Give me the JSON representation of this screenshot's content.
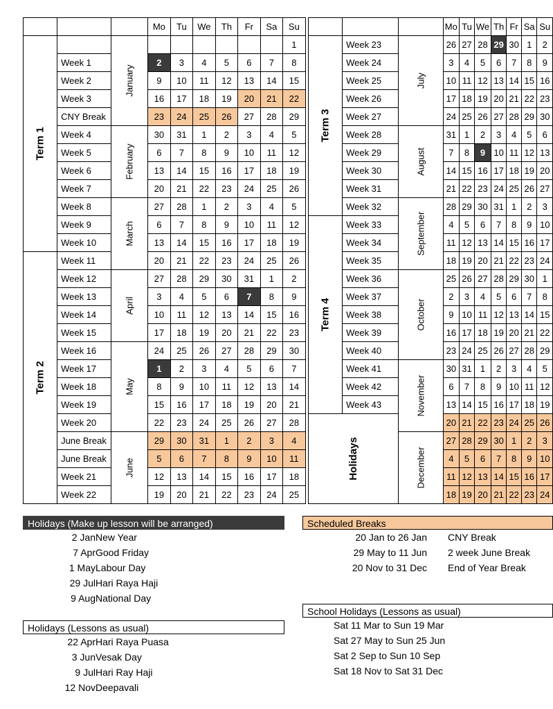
{
  "colors": {
    "accent_orange": "#f7c89c",
    "dark": "#3b3b3b",
    "border": "#000000"
  },
  "day_headers": [
    "Mo",
    "Tu",
    "We",
    "Th",
    "Fr",
    "Sa",
    "Su"
  ],
  "left_table": {
    "terms": [
      {
        "label": "Term 1",
        "rows": 12
      },
      {
        "label": "Term 2",
        "rows": 14
      }
    ],
    "months": [
      {
        "label": "January",
        "rows": 5
      },
      {
        "label": "February",
        "rows": 4
      },
      {
        "label": "March",
        "rows": 4
      },
      {
        "label": "April",
        "rows": 4
      },
      {
        "label": "May",
        "rows": 5
      },
      {
        "label": "June",
        "rows": 4
      }
    ],
    "rows": [
      {
        "week": "",
        "days": [
          "",
          "",
          "",
          "",
          "",
          "",
          "1"
        ],
        "marks": [
          "",
          "",
          "",
          "",
          "",
          "",
          ""
        ]
      },
      {
        "week": "Week 1",
        "days": [
          "2",
          "3",
          "4",
          "5",
          "6",
          "7",
          "8"
        ],
        "marks": [
          "dark",
          "",
          "",
          "",
          "",
          "",
          ""
        ]
      },
      {
        "week": "Week 2",
        "days": [
          "9",
          "10",
          "11",
          "12",
          "13",
          "14",
          "15"
        ],
        "marks": [
          "",
          "",
          "",
          "",
          "",
          "",
          ""
        ]
      },
      {
        "week": "Week 3",
        "days": [
          "16",
          "17",
          "18",
          "19",
          "20",
          "21",
          "22"
        ],
        "marks": [
          "",
          "",
          "",
          "",
          "orange",
          "orange",
          "orange"
        ]
      },
      {
        "week": "CNY Break",
        "days": [
          "23",
          "24",
          "25",
          "26",
          "27",
          "28",
          "29"
        ],
        "marks": [
          "orange",
          "orange",
          "orange",
          "orange",
          "",
          "",
          ""
        ]
      },
      {
        "week": "Week 4",
        "days": [
          "30",
          "31",
          "1",
          "2",
          "3",
          "4",
          "5"
        ],
        "marks": [
          "",
          "",
          "",
          "",
          "",
          "",
          ""
        ]
      },
      {
        "week": "Week 5",
        "days": [
          "6",
          "7",
          "8",
          "9",
          "10",
          "11",
          "12"
        ],
        "marks": [
          "",
          "",
          "",
          "",
          "",
          "",
          ""
        ]
      },
      {
        "week": "Week 6",
        "days": [
          "13",
          "14",
          "15",
          "16",
          "17",
          "18",
          "19"
        ],
        "marks": [
          "",
          "",
          "",
          "",
          "",
          "",
          ""
        ]
      },
      {
        "week": "Week 7",
        "days": [
          "20",
          "21",
          "22",
          "23",
          "24",
          "25",
          "26"
        ],
        "marks": [
          "",
          "",
          "",
          "",
          "",
          "",
          ""
        ]
      },
      {
        "week": "Week 8",
        "days": [
          "27",
          "28",
          "1",
          "2",
          "3",
          "4",
          "5"
        ],
        "marks": [
          "",
          "",
          "",
          "",
          "",
          "",
          ""
        ]
      },
      {
        "week": "Week 9",
        "days": [
          "6",
          "7",
          "8",
          "9",
          "10",
          "11",
          "12"
        ],
        "marks": [
          "",
          "",
          "",
          "",
          "",
          "",
          ""
        ]
      },
      {
        "week": "Week 10",
        "days": [
          "13",
          "14",
          "15",
          "16",
          "17",
          "18",
          "19"
        ],
        "marks": [
          "",
          "",
          "",
          "",
          "",
          "",
          ""
        ]
      },
      {
        "week": "Week 11",
        "days": [
          "20",
          "21",
          "22",
          "23",
          "24",
          "25",
          "26"
        ],
        "marks": [
          "",
          "",
          "",
          "",
          "",
          "",
          ""
        ]
      },
      {
        "week": "Week 12",
        "days": [
          "27",
          "28",
          "29",
          "30",
          "31",
          "1",
          "2"
        ],
        "marks": [
          "",
          "",
          "",
          "",
          "",
          "",
          ""
        ]
      },
      {
        "week": "Week 13",
        "days": [
          "3",
          "4",
          "5",
          "6",
          "7",
          "8",
          "9"
        ],
        "marks": [
          "",
          "",
          "",
          "",
          "dark",
          "",
          ""
        ]
      },
      {
        "week": "Week 14",
        "days": [
          "10",
          "11",
          "12",
          "13",
          "14",
          "15",
          "16"
        ],
        "marks": [
          "",
          "",
          "",
          "",
          "",
          "",
          ""
        ]
      },
      {
        "week": "Week 15",
        "days": [
          "17",
          "18",
          "19",
          "20",
          "21",
          "22",
          "23"
        ],
        "marks": [
          "",
          "",
          "",
          "",
          "",
          "",
          ""
        ]
      },
      {
        "week": "Week 16",
        "days": [
          "24",
          "25",
          "26",
          "27",
          "28",
          "29",
          "30"
        ],
        "marks": [
          "",
          "",
          "",
          "",
          "",
          "",
          ""
        ]
      },
      {
        "week": "Week 17",
        "days": [
          "1",
          "2",
          "3",
          "4",
          "5",
          "6",
          "7"
        ],
        "marks": [
          "dark",
          "",
          "",
          "",
          "",
          "",
          ""
        ]
      },
      {
        "week": "Week 18",
        "days": [
          "8",
          "9",
          "10",
          "11",
          "12",
          "13",
          "14"
        ],
        "marks": [
          "",
          "",
          "",
          "",
          "",
          "",
          ""
        ]
      },
      {
        "week": "Week 19",
        "days": [
          "15",
          "16",
          "17",
          "18",
          "19",
          "20",
          "21"
        ],
        "marks": [
          "",
          "",
          "",
          "",
          "",
          "",
          ""
        ]
      },
      {
        "week": "Week 20",
        "days": [
          "22",
          "23",
          "24",
          "25",
          "26",
          "27",
          "28"
        ],
        "marks": [
          "",
          "",
          "",
          "",
          "",
          "",
          ""
        ]
      },
      {
        "week": "June Break",
        "days": [
          "29",
          "30",
          "31",
          "1",
          "2",
          "3",
          "4"
        ],
        "marks": [
          "orange",
          "orange",
          "orange",
          "orange",
          "orange",
          "orange",
          "orange"
        ]
      },
      {
        "week": "June Break",
        "days": [
          "5",
          "6",
          "7",
          "8",
          "9",
          "10",
          "11"
        ],
        "marks": [
          "orange",
          "orange",
          "orange",
          "orange",
          "orange",
          "orange",
          "orange"
        ]
      },
      {
        "week": "Week 21",
        "days": [
          "12",
          "13",
          "14",
          "15",
          "16",
          "17",
          "18"
        ],
        "marks": [
          "",
          "",
          "",
          "",
          "",
          "",
          ""
        ]
      },
      {
        "week": "Week 22",
        "days": [
          "19",
          "20",
          "21",
          "22",
          "23",
          "24",
          "25"
        ],
        "marks": [
          "",
          "",
          "",
          "",
          "",
          "",
          ""
        ]
      }
    ]
  },
  "right_table": {
    "terms": [
      {
        "label": "Term 3",
        "rows": 10
      },
      {
        "label": "Term 4",
        "rows": 11
      },
      {
        "label": "Holidays",
        "rows": 5
      }
    ],
    "months": [
      {
        "label": "July",
        "rows": 5
      },
      {
        "label": "August",
        "rows": 4
      },
      {
        "label": "September",
        "rows": 4
      },
      {
        "label": "October",
        "rows": 5
      },
      {
        "label": "November",
        "rows": 4
      },
      {
        "label": "December",
        "rows": 4
      }
    ],
    "rows": [
      {
        "week": "Week 23",
        "days": [
          "26",
          "27",
          "28",
          "29",
          "30",
          "1",
          "2"
        ],
        "marks": [
          "",
          "",
          "",
          "dark",
          "",
          "",
          ""
        ]
      },
      {
        "week": "Week 24",
        "days": [
          "3",
          "4",
          "5",
          "6",
          "7",
          "8",
          "9"
        ],
        "marks": [
          "",
          "",
          "",
          "",
          "",
          "",
          ""
        ]
      },
      {
        "week": "Week 25",
        "days": [
          "10",
          "11",
          "12",
          "13",
          "14",
          "15",
          "16"
        ],
        "marks": [
          "",
          "",
          "",
          "",
          "",
          "",
          ""
        ]
      },
      {
        "week": "Week 26",
        "days": [
          "17",
          "18",
          "19",
          "20",
          "21",
          "22",
          "23"
        ],
        "marks": [
          "",
          "",
          "",
          "",
          "",
          "",
          ""
        ]
      },
      {
        "week": "Week 27",
        "days": [
          "24",
          "25",
          "26",
          "27",
          "28",
          "29",
          "30"
        ],
        "marks": [
          "",
          "",
          "",
          "",
          "",
          "",
          ""
        ]
      },
      {
        "week": "Week 28",
        "days": [
          "31",
          "1",
          "2",
          "3",
          "4",
          "5",
          "6"
        ],
        "marks": [
          "",
          "",
          "",
          "",
          "",
          "",
          ""
        ]
      },
      {
        "week": "Week 29",
        "days": [
          "7",
          "8",
          "9",
          "10",
          "11",
          "12",
          "13"
        ],
        "marks": [
          "",
          "",
          "dark",
          "",
          "",
          "",
          ""
        ]
      },
      {
        "week": "Week 30",
        "days": [
          "14",
          "15",
          "16",
          "17",
          "18",
          "19",
          "20"
        ],
        "marks": [
          "",
          "",
          "",
          "",
          "",
          "",
          ""
        ]
      },
      {
        "week": "Week 31",
        "days": [
          "21",
          "22",
          "23",
          "24",
          "25",
          "26",
          "27"
        ],
        "marks": [
          "",
          "",
          "",
          "",
          "",
          "",
          ""
        ]
      },
      {
        "week": "Week 32",
        "days": [
          "28",
          "29",
          "30",
          "31",
          "1",
          "2",
          "3"
        ],
        "marks": [
          "",
          "",
          "",
          "",
          "",
          "",
          ""
        ]
      },
      {
        "week": "Week 33",
        "days": [
          "4",
          "5",
          "6",
          "7",
          "8",
          "9",
          "10"
        ],
        "marks": [
          "",
          "",
          "",
          "",
          "",
          "",
          ""
        ]
      },
      {
        "week": "Week 34",
        "days": [
          "11",
          "12",
          "13",
          "14",
          "15",
          "16",
          "17"
        ],
        "marks": [
          "",
          "",
          "",
          "",
          "",
          "",
          ""
        ]
      },
      {
        "week": "Week 35",
        "days": [
          "18",
          "19",
          "20",
          "21",
          "22",
          "23",
          "24"
        ],
        "marks": [
          "",
          "",
          "",
          "",
          "",
          "",
          ""
        ]
      },
      {
        "week": "Week 36",
        "days": [
          "25",
          "26",
          "27",
          "28",
          "29",
          "30",
          "1"
        ],
        "marks": [
          "",
          "",
          "",
          "",
          "",
          "",
          ""
        ]
      },
      {
        "week": "Week 37",
        "days": [
          "2",
          "3",
          "4",
          "5",
          "6",
          "7",
          "8"
        ],
        "marks": [
          "",
          "",
          "",
          "",
          "",
          "",
          ""
        ]
      },
      {
        "week": "Week 38",
        "days": [
          "9",
          "10",
          "11",
          "12",
          "13",
          "14",
          "15"
        ],
        "marks": [
          "",
          "",
          "",
          "",
          "",
          "",
          ""
        ]
      },
      {
        "week": "Week 39",
        "days": [
          "16",
          "17",
          "18",
          "19",
          "20",
          "21",
          "22"
        ],
        "marks": [
          "",
          "",
          "",
          "",
          "",
          "",
          ""
        ]
      },
      {
        "week": "Week 40",
        "days": [
          "23",
          "24",
          "25",
          "26",
          "27",
          "28",
          "29"
        ],
        "marks": [
          "",
          "",
          "",
          "",
          "",
          "",
          ""
        ]
      },
      {
        "week": "Week 41",
        "days": [
          "30",
          "31",
          "1",
          "2",
          "3",
          "4",
          "5"
        ],
        "marks": [
          "",
          "",
          "",
          "",
          "",
          "",
          ""
        ]
      },
      {
        "week": "Week 42",
        "days": [
          "6",
          "7",
          "8",
          "9",
          "10",
          "11",
          "12"
        ],
        "marks": [
          "",
          "",
          "",
          "",
          "",
          "",
          ""
        ]
      },
      {
        "week": "Week 43",
        "days": [
          "13",
          "14",
          "15",
          "16",
          "17",
          "18",
          "19"
        ],
        "marks": [
          "",
          "",
          "",
          "",
          "",
          "",
          ""
        ]
      },
      {
        "week": "",
        "days": [
          "20",
          "21",
          "22",
          "23",
          "24",
          "25",
          "26"
        ],
        "marks": [
          "orange",
          "orange",
          "orange",
          "orange",
          "orange",
          "orange",
          "orange"
        ]
      },
      {
        "week": "",
        "days": [
          "27",
          "28",
          "29",
          "30",
          "1",
          "2",
          "3"
        ],
        "marks": [
          "orange",
          "orange",
          "orange",
          "orange",
          "orange",
          "orange",
          "orange"
        ]
      },
      {
        "week": "",
        "days": [
          "4",
          "5",
          "6",
          "7",
          "8",
          "9",
          "10"
        ],
        "marks": [
          "orange",
          "orange",
          "orange",
          "orange",
          "orange",
          "orange",
          "orange"
        ]
      },
      {
        "week": "",
        "days": [
          "11",
          "12",
          "13",
          "14",
          "15",
          "16",
          "17"
        ],
        "marks": [
          "orange",
          "orange",
          "orange",
          "orange",
          "orange",
          "orange",
          "orange"
        ]
      },
      {
        "week": "",
        "days": [
          "18",
          "19",
          "20",
          "21",
          "22",
          "23",
          "24"
        ],
        "marks": [
          "orange",
          "orange",
          "orange",
          "orange",
          "orange",
          "orange",
          "orange"
        ]
      }
    ]
  },
  "legends": {
    "holidays_makeup": {
      "title": "Holidays (Make up lesson will be arranged)",
      "items": [
        {
          "date": "2 Jan",
          "name": "New Year"
        },
        {
          "date": "7 Apr",
          "name": "Good Friday"
        },
        {
          "date": "1 May",
          "name": "Labour Day"
        },
        {
          "date": "29 Jul",
          "name": "Hari Raya Haji"
        },
        {
          "date": "9 Aug",
          "name": "National Day"
        }
      ]
    },
    "holidays_usual": {
      "title": "Holidays (Lessons as usual)",
      "items": [
        {
          "date": "22 Apr",
          "name": "Hari Raya Puasa"
        },
        {
          "date": "3 Jun",
          "name": "Vesak Day"
        },
        {
          "date": "9 Jul",
          "name": "Hari Ray Haji"
        },
        {
          "date": "12 Nov",
          "name": "Deepavali"
        }
      ]
    },
    "scheduled_breaks": {
      "title": "Scheduled Breaks",
      "items": [
        {
          "date": "20 Jan to 26 Jan",
          "name": "CNY Break"
        },
        {
          "date": "29 May to 11 Jun",
          "name": "2 week June Break"
        },
        {
          "date": "20 Nov to 31 Dec",
          "name": "End of Year Break"
        }
      ]
    },
    "school_holidays": {
      "title": "School Holidays (Lessons as usual)",
      "items": [
        {
          "range": "Sat 11 Mar to Sun 19 Mar"
        },
        {
          "range": "Sat 27 May to Sun 25 Jun"
        },
        {
          "range": "Sat 2 Sep to Sun 10 Sep"
        },
        {
          "range": "Sat 18 Nov to Sat 31 Dec"
        }
      ]
    }
  }
}
